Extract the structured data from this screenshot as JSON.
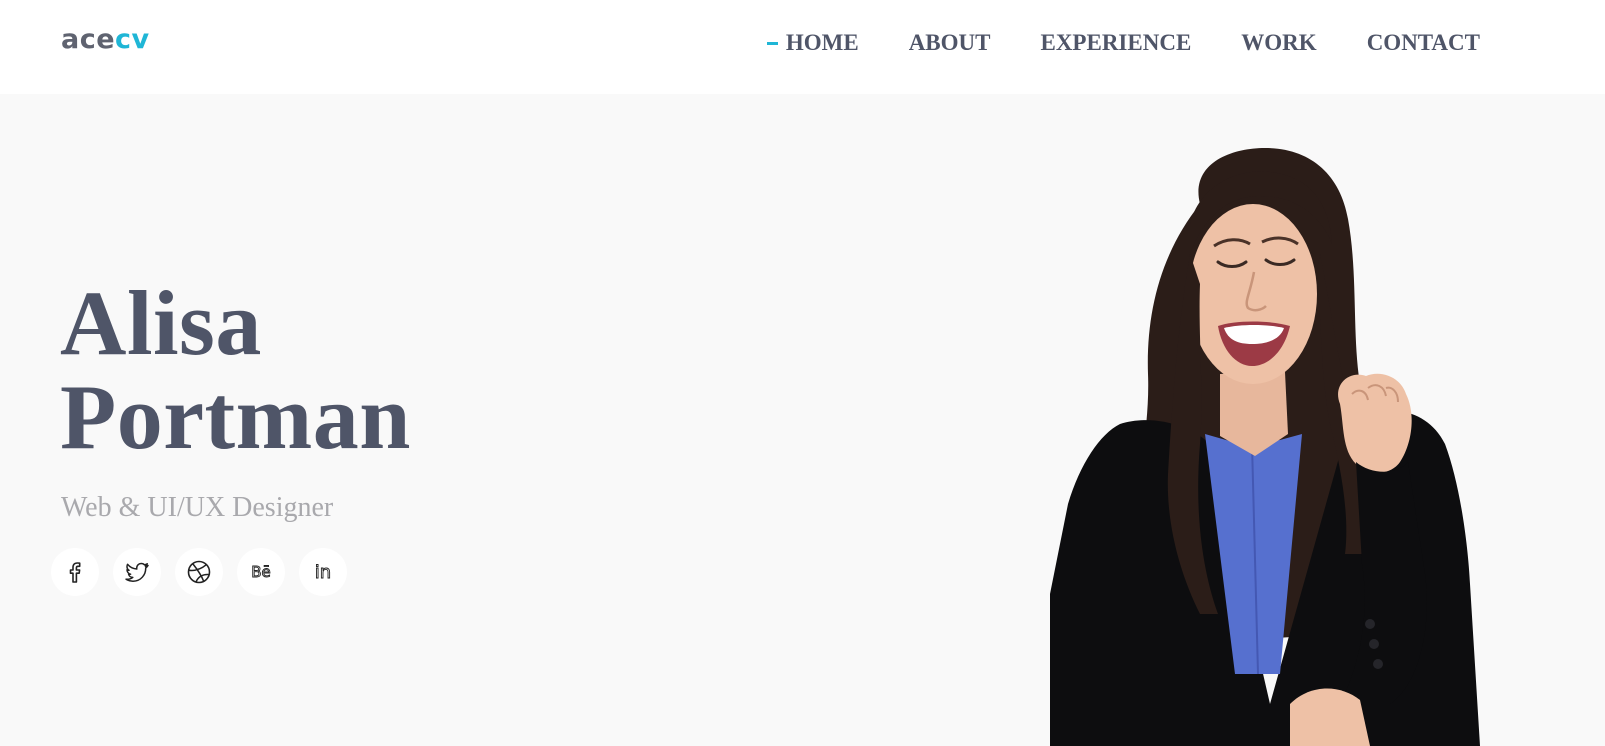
{
  "header": {
    "logo": {
      "part1": "ace",
      "part2": "cv"
    },
    "nav": [
      {
        "label": "HOME",
        "active": true
      },
      {
        "label": "ABOUT"
      },
      {
        "label": "EXPERIENCE"
      },
      {
        "label": "WORK"
      },
      {
        "label": "CONTACT"
      }
    ]
  },
  "hero": {
    "name_line1": "Alisa",
    "name_line2": "Portman",
    "role": "Web & UI/UX Designer",
    "socials": [
      {
        "icon": "facebook-icon"
      },
      {
        "icon": "twitter-icon"
      },
      {
        "icon": "dribbble-icon"
      },
      {
        "icon": "behance-icon",
        "glyph": "Bē"
      },
      {
        "icon": "linkedin-icon",
        "glyph": "in"
      }
    ]
  },
  "colors": {
    "accent": "#1fb6d6",
    "text_dark": "#4f5568",
    "text_muted": "#a9a9ad",
    "hero_bg": "#f9f9f9"
  }
}
